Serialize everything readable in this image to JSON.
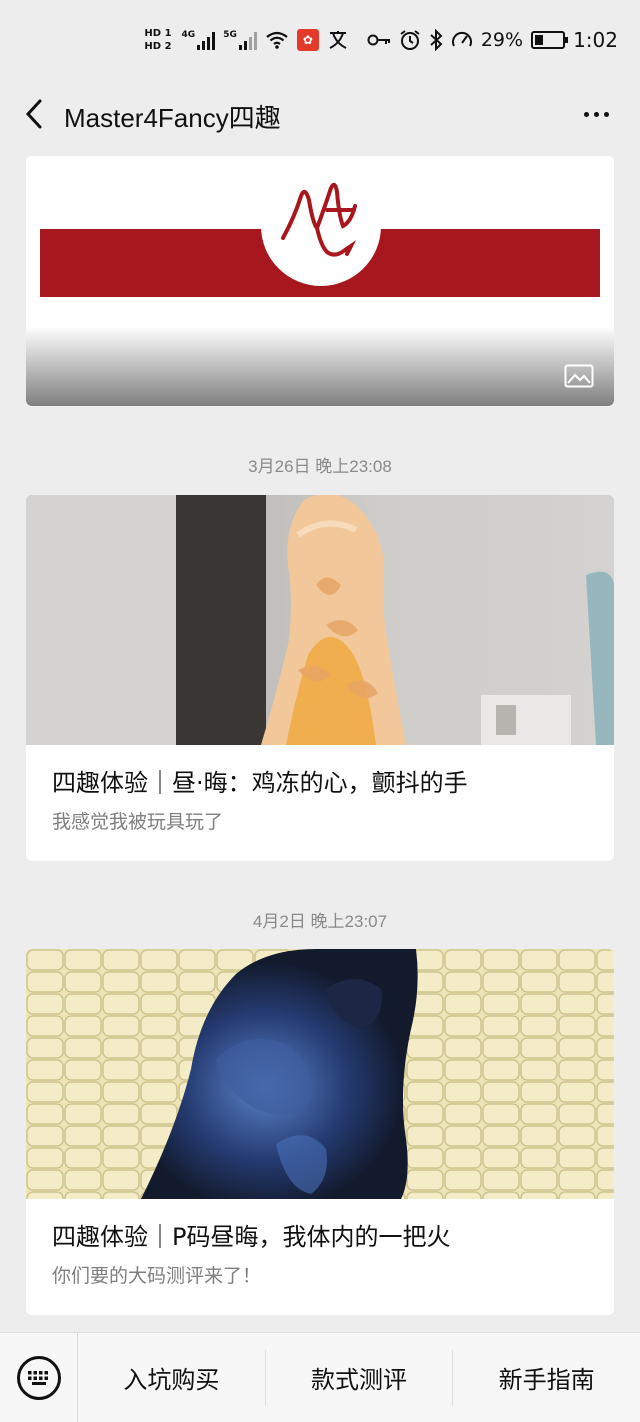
{
  "status_bar": {
    "hd1": "HD 1",
    "hd2": "HD 2",
    "net1": "4G",
    "net2": "5G",
    "battery_percent": "29%",
    "battery_level": 0.29,
    "time": "1:02",
    "icons": [
      "signal-icon",
      "wifi-icon",
      "app-notification-icon",
      "translate-icon",
      "key-icon",
      "alarm-icon",
      "bluetooth-icon",
      "speed-icon",
      "battery-icon"
    ]
  },
  "nav": {
    "title": "Master4Fancy四趣",
    "back_icon": "chevron-left-icon",
    "more_icon": "more-dots-icon"
  },
  "feed": {
    "banner": {
      "colors": {
        "stripe": "#a8171e",
        "logo": "#a8171e"
      }
    },
    "articles": [
      {
        "timestamp": "3月26日 晚上23:08",
        "title": "四趣体验｜昼·晦：鸡冻的心，颤抖的手",
        "digest": "我感觉我被玩具玩了"
      },
      {
        "timestamp": "4月2日 晚上23:07",
        "title": "四趣体验｜P码昼晦，我体内的一把火",
        "digest": "你们要的大码测评来了！"
      }
    ]
  },
  "bottom_menu": {
    "keyboard_icon": "keyboard-icon",
    "items": [
      "入坑购买",
      "款式测评",
      "新手指南"
    ]
  }
}
